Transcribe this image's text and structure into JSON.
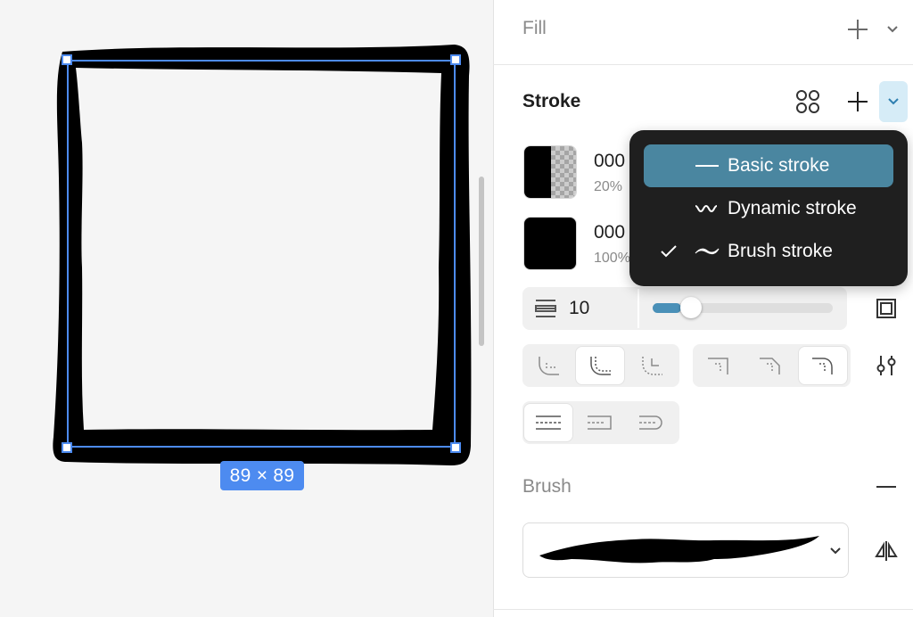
{
  "canvas": {
    "size_label": "89 × 89"
  },
  "fill": {
    "title": "Fill"
  },
  "stroke": {
    "title": "Stroke",
    "paints": [
      {
        "hex": "000",
        "opacity": "20%"
      },
      {
        "hex": "000",
        "opacity": "100%"
      }
    ],
    "weight": "10",
    "weight_slider": 0.1
  },
  "stroke_type_menu": {
    "items": [
      {
        "label": "Basic stroke",
        "icon": "basic-stroke-icon",
        "checked": false,
        "highlighted": true
      },
      {
        "label": "Dynamic stroke",
        "icon": "dynamic-stroke-icon",
        "checked": false,
        "highlighted": false
      },
      {
        "label": "Brush stroke",
        "icon": "brush-stroke-icon",
        "checked": true,
        "highlighted": false
      }
    ]
  },
  "brush": {
    "title": "Brush"
  },
  "colors": {
    "selection": "#4d8bf0",
    "menu_bg": "#1f1f1f",
    "menu_highlight": "#4a86a0",
    "slider_fill": "#4a90b8"
  }
}
